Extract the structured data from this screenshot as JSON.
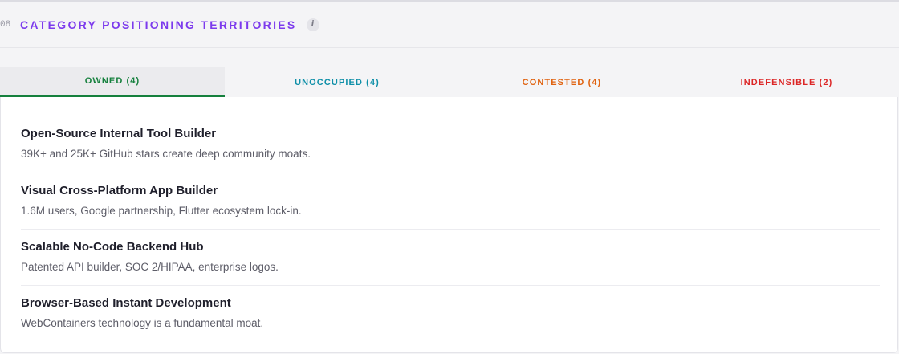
{
  "section": {
    "number": "08",
    "title": "CATEGORY POSITIONING TERRITORIES",
    "info_icon": "info-icon"
  },
  "tabs": [
    {
      "label": "OWNED (4)",
      "active": true,
      "color": "#15803d"
    },
    {
      "label": "UNOCCUPIED (4)",
      "active": false,
      "color": "#0e8fa8"
    },
    {
      "label": "CONTESTED (4)",
      "active": false,
      "color": "#e0620f"
    },
    {
      "label": "INDEFENSIBLE (2)",
      "active": false,
      "color": "#dc2626"
    }
  ],
  "items": [
    {
      "title": "Open-Source Internal Tool Builder",
      "description": "39K+ and 25K+ GitHub stars create deep community moats."
    },
    {
      "title": "Visual Cross-Platform App Builder",
      "description": "1.6M users, Google partnership, Flutter ecosystem lock-in."
    },
    {
      "title": "Scalable No-Code Backend Hub",
      "description": "Patented API builder, SOC 2/HIPAA, enterprise logos."
    },
    {
      "title": "Browser-Based Instant Development",
      "description": "WebContainers technology is a fundamental moat."
    }
  ],
  "colors": {
    "accent": "#7c3aed"
  }
}
